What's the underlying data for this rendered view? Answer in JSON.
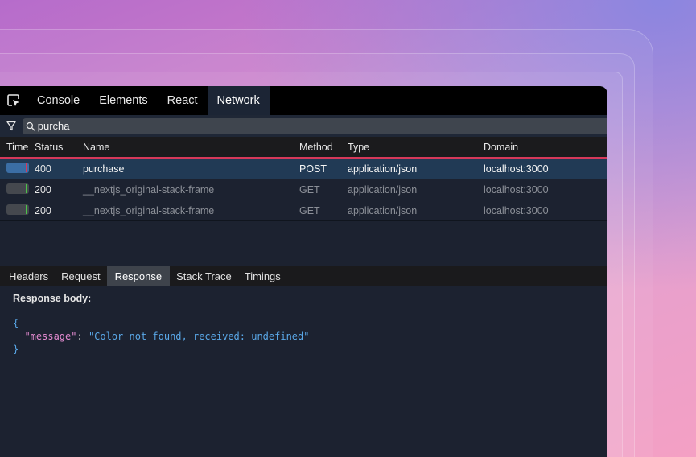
{
  "devtools": {
    "tabs": [
      {
        "label": "Console",
        "active": false
      },
      {
        "label": "Elements",
        "active": false
      },
      {
        "label": "React",
        "active": false
      },
      {
        "label": "Network",
        "active": true
      }
    ],
    "filter": {
      "value": "purcha"
    },
    "table": {
      "columns": [
        "Time",
        "Status",
        "Name",
        "Method",
        "Type",
        "Domain"
      ],
      "rows": [
        {
          "status": "400",
          "name": "purchase",
          "method": "POST",
          "type": "application/json",
          "domain": "localhost:3000",
          "selected": true,
          "bar_color": "#3b6ea5",
          "tick_color": "#d6395a"
        },
        {
          "status": "200",
          "name": "__nextjs_original-stack-frame",
          "method": "GET",
          "type": "application/json",
          "domain": "localhost:3000",
          "selected": false,
          "bar_color": "#45484e",
          "tick_color": "#4cc24a"
        },
        {
          "status": "200",
          "name": "__nextjs_original-stack-frame",
          "method": "GET",
          "type": "application/json",
          "domain": "localhost:3000",
          "selected": false,
          "bar_color": "#45484e",
          "tick_color": "#4cc24a"
        }
      ]
    },
    "detail_tabs": [
      {
        "label": "Headers",
        "active": false
      },
      {
        "label": "Request",
        "active": false
      },
      {
        "label": "Response",
        "active": true
      },
      {
        "label": "Stack Trace",
        "active": false
      },
      {
        "label": "Timings",
        "active": false
      }
    ],
    "response": {
      "title": "Response body:",
      "open_brace": "{",
      "key": "\"message\"",
      "colon": ": ",
      "value": "\"Color not found, received: undefined\"",
      "close_brace": "}"
    }
  },
  "icons": {
    "inspect": "inspect-element-icon",
    "filter": "filter-icon",
    "search": "search-icon"
  },
  "colors": {
    "error_accent": "#d6395a",
    "success_accent": "#4cc24a",
    "selected_row": "#213a55"
  }
}
